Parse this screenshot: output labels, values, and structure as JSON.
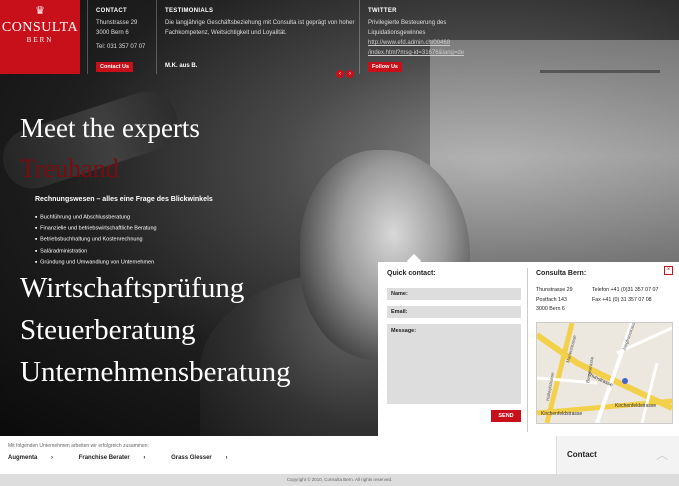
{
  "brand": {
    "crown_icon": "crown-icon",
    "name": "CONSULTA",
    "city": "BERN",
    "color": "#c8101a"
  },
  "contact": {
    "heading": "CONTACT",
    "street": "Thunstrasse 29",
    "city": "3000 Bern 6",
    "phone": "Tel: 031 357 07 07",
    "button": "Contact Us"
  },
  "testimonials": {
    "heading": "TESTIMONIALS",
    "text": "Die langjährige Geschäftsbeziehung mit Consulta ist geprägt von hoher Fachkompetenz, Weitsichtigkeit und Loyalität.",
    "author": "M.K. aus B.",
    "prev": "‹",
    "next": "›"
  },
  "twitter": {
    "heading": "TWITTER",
    "text": "Privilegierte Besteuerung des Liquidationsgewinnes",
    "link1": "http://www.efd.admin.ch/00468",
    "link2": "/index.html?msg-id=31676&lang=de",
    "button": "Follow Us"
  },
  "hero": {
    "headline": "Meet the experts",
    "headline_red": "Treuhand",
    "subtitle": "Rechnungswesen – alles eine Frage des Blickwinkels",
    "bullets": [
      "Buchführung und Abschlussberatung",
      "Finanzielle und betriebswirtschaftliche Beratung",
      "Betriebsbuchhaltung und Kostenrechnung",
      "Saläradministration",
      "Gründung und Umwandlung von Unternehmen"
    ],
    "services": [
      "Wirtschaftsprüfung",
      "Steuerberatung",
      "Unternehmensberatung"
    ]
  },
  "quick_contact": {
    "heading": "Quick contact:",
    "name_placeholder": "Name:",
    "email_placeholder": "Email:",
    "message_placeholder": "Message:",
    "send": "SEND",
    "close": "×"
  },
  "office": {
    "heading": "Consulta Bern:",
    "street": "Thunstrasse 29",
    "postbox": "Postfach 143",
    "city": "3000 Bern 6",
    "phone": "Telefon +41 (0)31 357 07 07",
    "fax": "Fax +41 (0) 31 357 07 08",
    "map_streets": [
      "Kirchenfeldstrasse",
      "Thunstrasse",
      "Kirchenfeldstrasse",
      "Hallwylstrasse",
      "Bernastrasse",
      "Marienstrasse",
      "Jungfraustrasse"
    ]
  },
  "partners": {
    "intro": "Mit folgenden Unternehmen arbeiten wir erfolgreich zusammen:",
    "items": [
      "Augmenta",
      "Franchise Berater",
      "Grass Glesser"
    ],
    "arrow": "›"
  },
  "contact_tab": {
    "label": "Contact",
    "chevron": "︿"
  },
  "footer": {
    "copyright": "Copyright © 2010, Consulta Bern. All rights reserved."
  }
}
